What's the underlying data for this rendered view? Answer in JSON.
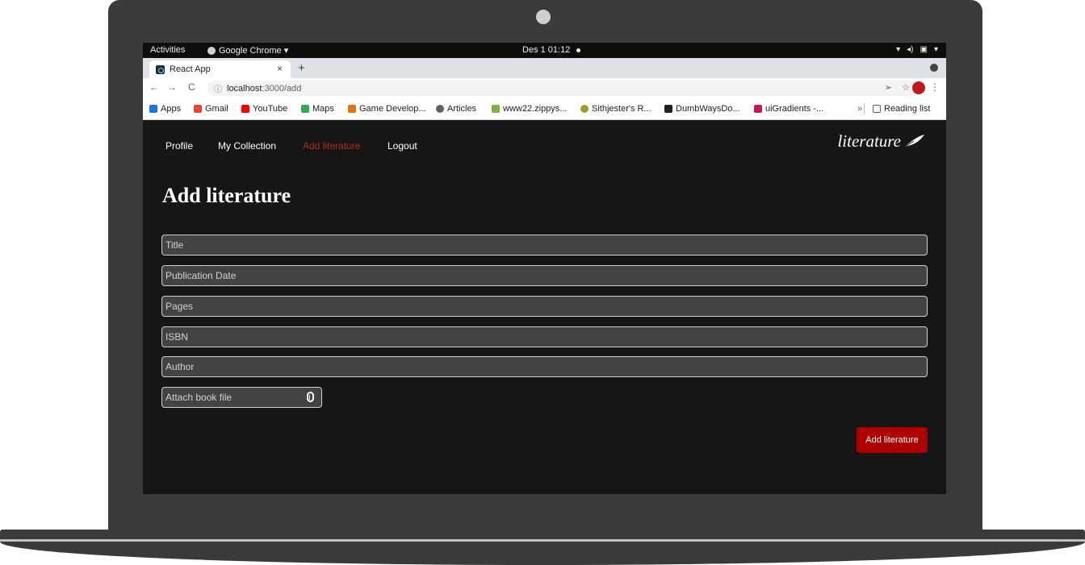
{
  "os_bar": {
    "activities": "Activities",
    "app_name": "Google Chrome ▾",
    "clock": "Des 1  01:12",
    "tray": [
      "▾",
      "◂)",
      "▣",
      "▾"
    ]
  },
  "browser": {
    "tab_title": "React App",
    "tab_close": "×",
    "new_tab": "+",
    "back": "←",
    "forward": "→",
    "reload": "C",
    "info": "ⓘ",
    "url_host": "localhost",
    "url_path": ":3000/add",
    "share": "➢",
    "star": "☆",
    "menu": "⋮",
    "bookmarks": [
      {
        "label": "Apps",
        "color": "#1a73e8"
      },
      {
        "label": "Gmail",
        "color": "#ea4335"
      },
      {
        "label": "YouTube",
        "color": "#ff0000"
      },
      {
        "label": "Maps",
        "color": "#34a853"
      },
      {
        "label": "Game Develop...",
        "color": "#e8710a"
      },
      {
        "label": "Articles",
        "color": "#5f6368"
      },
      {
        "label": "www22.zippys...",
        "color": "#7cb342"
      },
      {
        "label": "Sithjester's R...",
        "color": "#9e9d24"
      },
      {
        "label": "DumbWaysDo...",
        "color": "#202124"
      },
      {
        "label": "uiGradients -...",
        "color": "#c2185b"
      }
    ],
    "bookmarks_more": "»",
    "reading_list": "Reading list"
  },
  "app": {
    "nav": [
      "Profile",
      "My Collection",
      "Add literature",
      "Logout"
    ],
    "active_nav": "Add literature",
    "brand": "literature",
    "page_title": "Add literature",
    "fields": [
      {
        "placeholder": "Title"
      },
      {
        "placeholder": "Publication Date"
      },
      {
        "placeholder": "Pages"
      },
      {
        "placeholder": "ISBN"
      },
      {
        "placeholder": "Author"
      }
    ],
    "attach_label": "Attach book file",
    "submit_label": "Add literature"
  },
  "colors": {
    "accent_red": "#af0000",
    "active_nav": "#af2e1c",
    "background": "#161616"
  }
}
